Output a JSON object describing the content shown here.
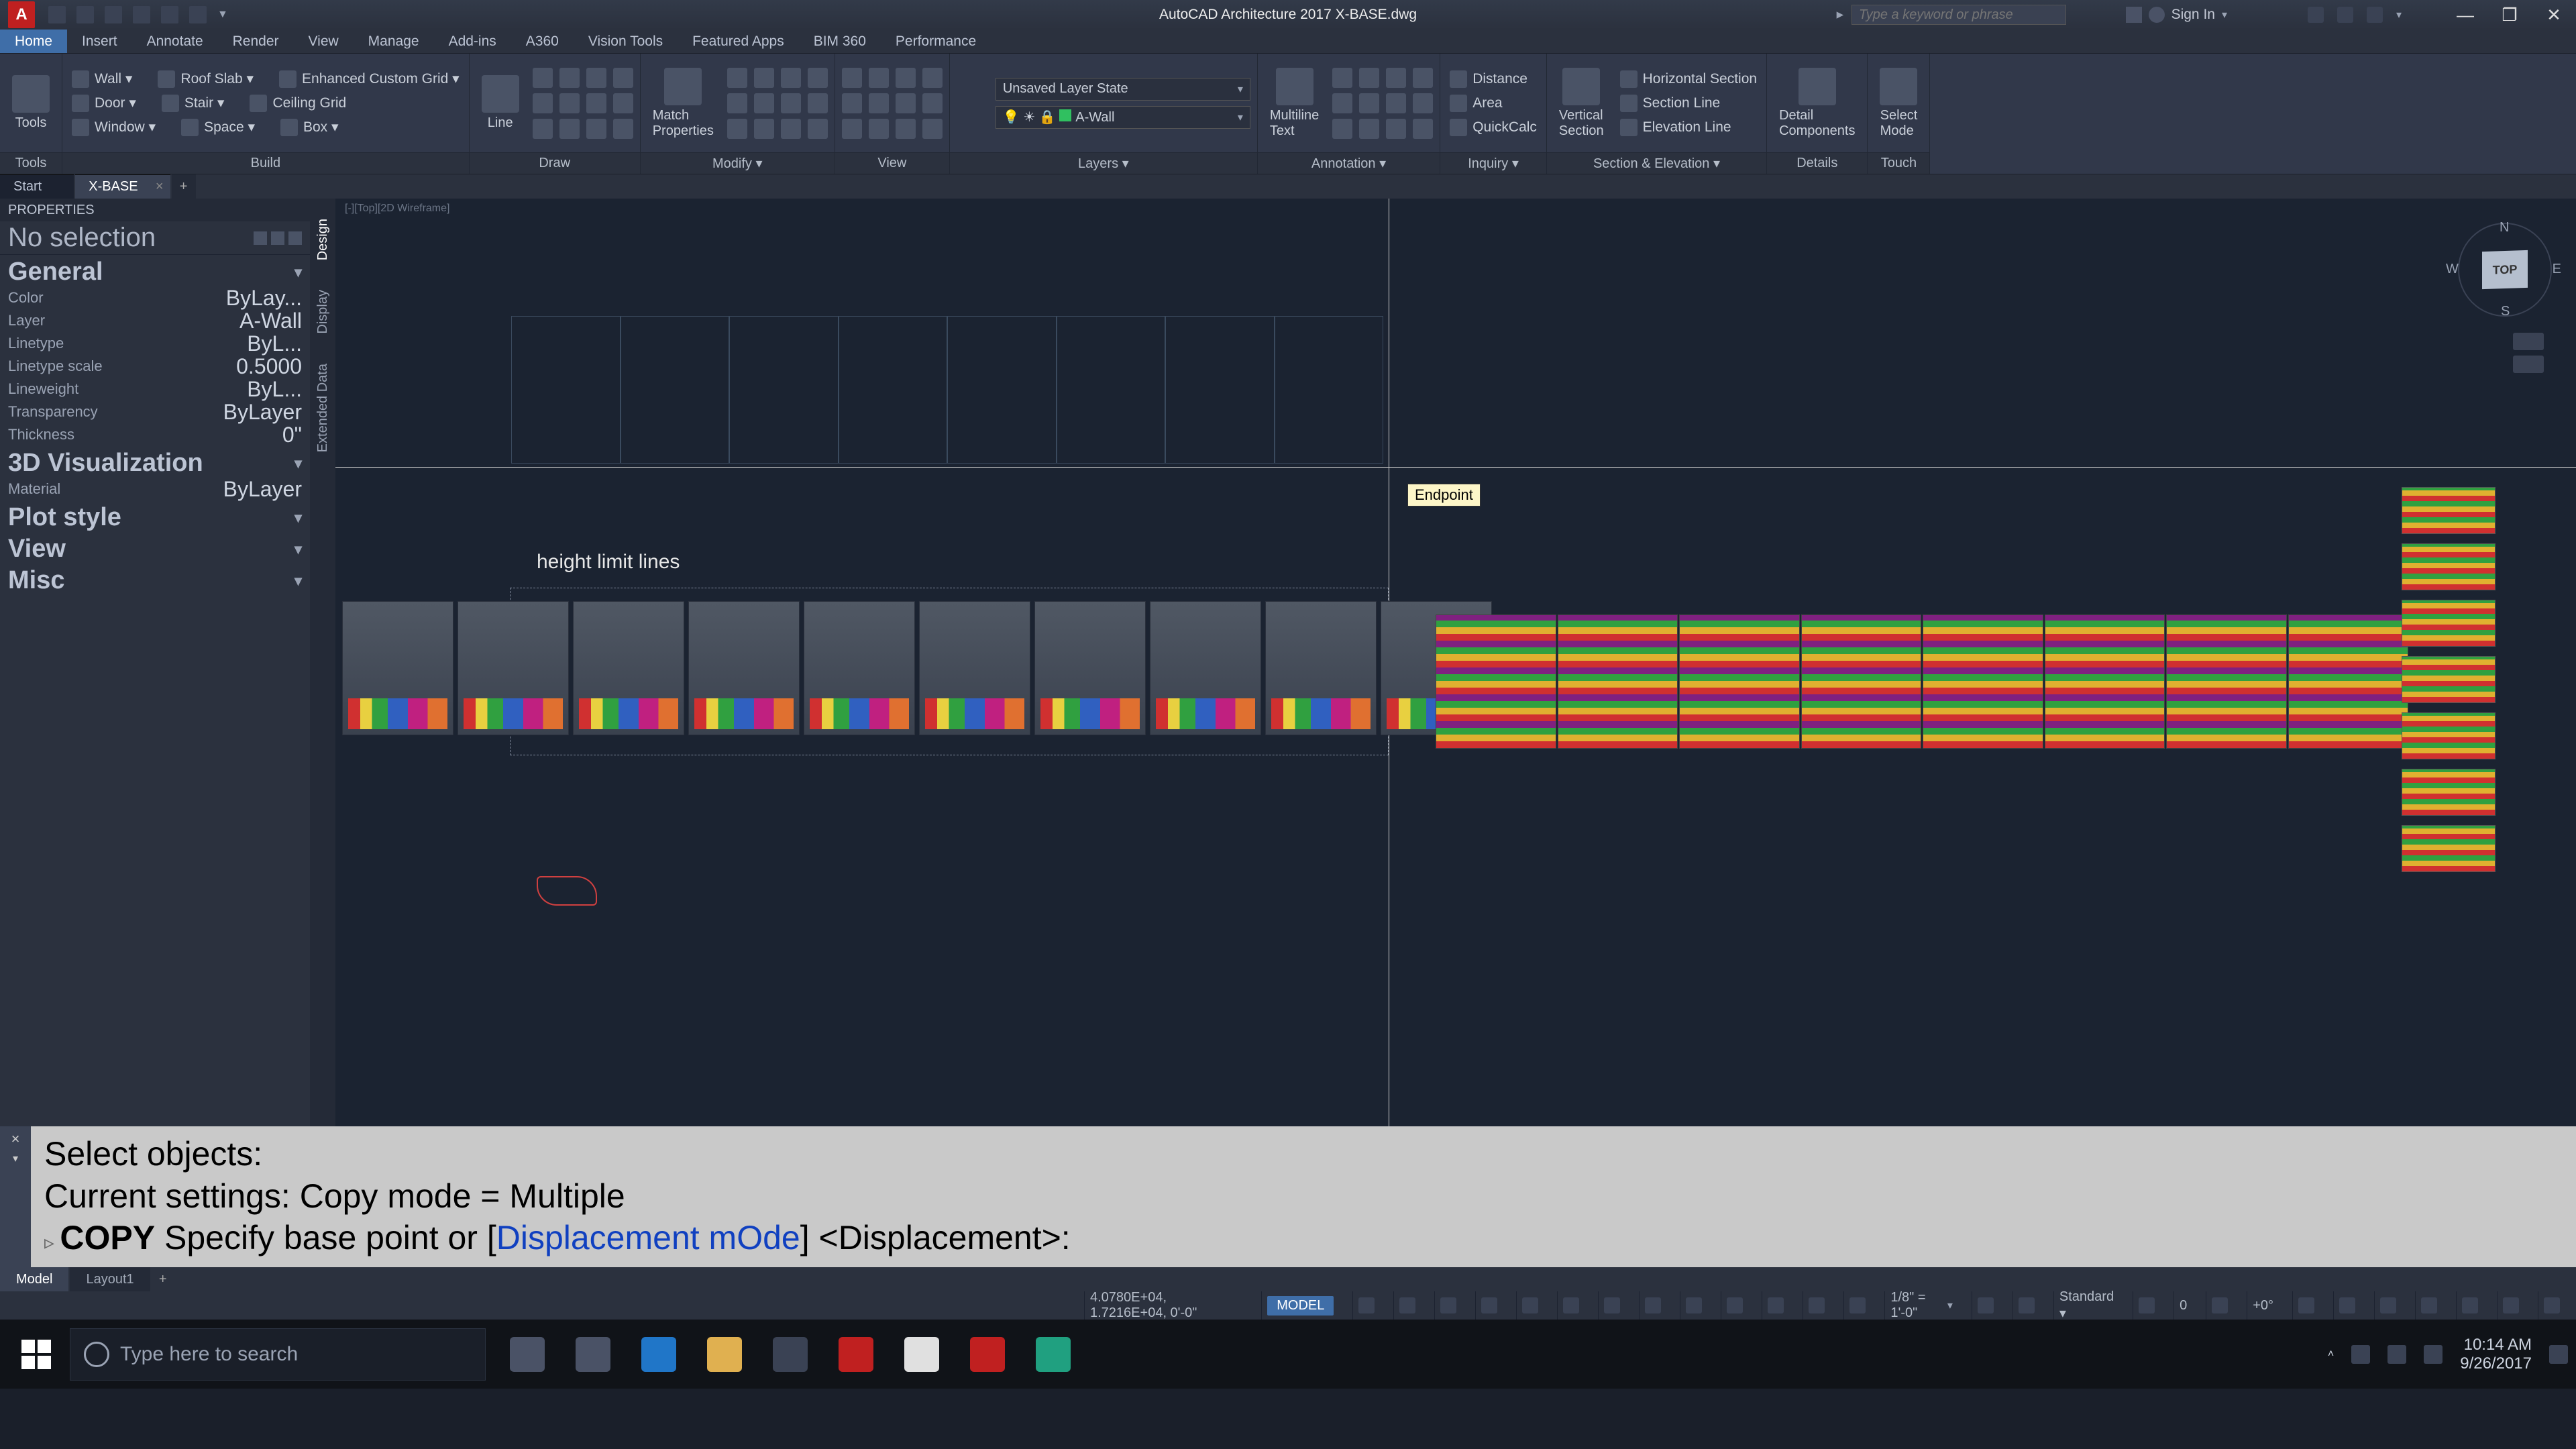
{
  "app": {
    "title": "AutoCAD Architecture 2017   X-BASE.dwg",
    "logo_letter": "A",
    "signin": "Sign In",
    "search_placeholder": "Type a keyword or phrase",
    "win": {
      "min": "—",
      "max": "❐",
      "close": "✕"
    }
  },
  "menubar": [
    "Home",
    "Insert",
    "Annotate",
    "Render",
    "View",
    "Manage",
    "Add-ins",
    "A360",
    "Vision Tools",
    "Featured Apps",
    "BIM 360",
    "Performance"
  ],
  "menubar_active_index": 0,
  "ribbon": {
    "panels": [
      {
        "label": "Tools",
        "big": [
          {
            "label": "Tools"
          }
        ],
        "rows": []
      },
      {
        "label": "Build",
        "big": [],
        "rows": [
          [
            "Wall ▾",
            "Roof Slab ▾",
            "Enhanced Custom Grid ▾"
          ],
          [
            "Door ▾",
            "Stair ▾",
            "Ceiling Grid"
          ],
          [
            "Window ▾",
            "Space ▾",
            "Box ▾"
          ]
        ]
      },
      {
        "label": "Draw",
        "big": [
          {
            "label": "Line"
          }
        ],
        "iconstrip": true
      },
      {
        "label": "Modify ▾",
        "big": [
          {
            "label": "Match\nProperties"
          }
        ],
        "iconstrip": true
      },
      {
        "label": "View",
        "big": [],
        "iconstrip": true
      },
      {
        "label": "Layers ▾",
        "combo_top": "Unsaved Layer State",
        "combo_bottom": "A-Wall"
      },
      {
        "label": "Annotation ▾",
        "big": [
          {
            "label": "Multiline\nText"
          }
        ],
        "iconstrip": true
      },
      {
        "label": "Inquiry ▾",
        "rows": [
          [
            "Distance"
          ],
          [
            "Area"
          ],
          [
            "QuickCalc"
          ]
        ]
      },
      {
        "label": "Section & Elevation ▾",
        "big": [
          {
            "label": "Vertical\nSection"
          }
        ],
        "rows": [
          [
            "Horizontal Section"
          ],
          [
            "Section Line"
          ],
          [
            "Elevation Line"
          ]
        ]
      },
      {
        "label": "Details",
        "big": [
          {
            "label": "Detail\nComponents"
          }
        ]
      },
      {
        "label": "Touch",
        "big": [
          {
            "label": "Select\nMode"
          }
        ]
      }
    ]
  },
  "doctabs": [
    {
      "label": "Start",
      "active": false,
      "closable": false
    },
    {
      "label": "X-BASE",
      "active": true,
      "closable": true
    }
  ],
  "properties": {
    "title": "PROPERTIES",
    "selection": "No selection",
    "sections": [
      {
        "name": "General",
        "rows": [
          {
            "k": "Color",
            "v": "ByLay..."
          },
          {
            "k": "Layer",
            "v": "A-Wall"
          },
          {
            "k": "Linetype",
            "v": "ByL..."
          },
          {
            "k": "Linetype scale",
            "v": "0.5000"
          },
          {
            "k": "Lineweight",
            "v": "ByL..."
          },
          {
            "k": "Transparency",
            "v": "ByLayer"
          },
          {
            "k": "Thickness",
            "v": "0\""
          }
        ]
      },
      {
        "name": "3D Visualization",
        "rows": [
          {
            "k": "Material",
            "v": "ByLayer"
          }
        ]
      },
      {
        "name": "Plot style",
        "rows": []
      },
      {
        "name": "View",
        "rows": []
      },
      {
        "name": "Misc",
        "rows": []
      }
    ],
    "sidetabs": [
      "Design",
      "Display",
      "Extended Data"
    ]
  },
  "canvas": {
    "visual_style": "[-][Top][2D Wireframe]",
    "tooltip": "Endpoint",
    "annotation": "height limit lines",
    "navcube": {
      "face": "TOP",
      "n": "N",
      "s": "S",
      "e": "E",
      "w": "W"
    }
  },
  "cmd": {
    "line1": "Select objects:",
    "line2": "Current settings:  Copy mode = Multiple",
    "prefix": "COPY",
    "body": " Specify base point or [",
    "opt1": "Displacement",
    "mid": " ",
    "opt2": "mOde",
    "tail": "] <Displacement>:"
  },
  "layouttabs": [
    {
      "label": "Model",
      "active": true
    },
    {
      "label": "Layout1",
      "active": false
    }
  ],
  "status": {
    "coords": "4.0780E+04, 1.7216E+04, 0'-0\"",
    "model": "MODEL",
    "scale": "1/8\" = 1'-0\"",
    "annoscale": "Standard ▾",
    "angle": "0",
    "angle2": "+0°"
  },
  "taskbar": {
    "search_placeholder": "Type here to search",
    "time": "10:14 AM",
    "date": "9/26/2017",
    "apps": [
      {
        "name": "mic",
        "color": "#4a5266"
      },
      {
        "name": "taskview",
        "color": "#4a5266"
      },
      {
        "name": "edge",
        "color": "#2076c8"
      },
      {
        "name": "explorer",
        "color": "#e0b050"
      },
      {
        "name": "store",
        "color": "#3a4254"
      },
      {
        "name": "mcafee",
        "color": "#c02020"
      },
      {
        "name": "chrome",
        "color": "#e0e0e0"
      },
      {
        "name": "autocad",
        "color": "#c02020"
      },
      {
        "name": "3dsmax",
        "color": "#20a080"
      }
    ]
  }
}
